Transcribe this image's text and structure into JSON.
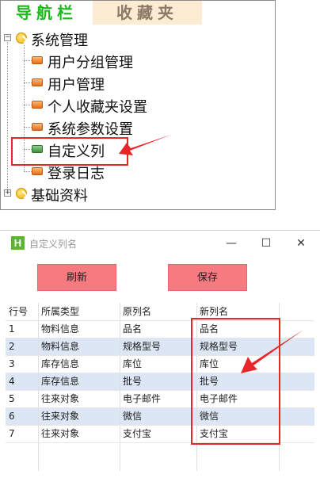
{
  "nav": {
    "tab_active": "导航栏",
    "tab_inactive": "收藏夹",
    "tree": [
      {
        "label": "系统管理",
        "kind": "root",
        "expanded": true
      },
      {
        "label": "用户分组管理",
        "kind": "leaf"
      },
      {
        "label": "用户管理",
        "kind": "leaf"
      },
      {
        "label": "个人收藏夹设置",
        "kind": "leaf"
      },
      {
        "label": "系统参数设置",
        "kind": "leaf"
      },
      {
        "label": "自定义列",
        "kind": "leaf",
        "selected": true
      },
      {
        "label": "登录日志",
        "kind": "leaf"
      },
      {
        "label": "基础资料",
        "kind": "root",
        "expanded": false
      }
    ],
    "expander_minus": "−",
    "expander_plus": "+"
  },
  "dialog": {
    "app_icon_letter": "H",
    "title": "自定义列名",
    "btn_minimize": "—",
    "btn_maximize": "☐",
    "btn_close": "✕",
    "refresh_label": "刷新",
    "save_label": "保存"
  },
  "grid": {
    "headers": [
      "行号",
      "所属类型",
      "原列名",
      "新列名"
    ],
    "rows": [
      [
        "1",
        "物料信息",
        "品名",
        "品名"
      ],
      [
        "2",
        "物料信息",
        "规格型号",
        "规格型号"
      ],
      [
        "3",
        "库存信息",
        "库位",
        "库位"
      ],
      [
        "4",
        "库存信息",
        "批号",
        "批号"
      ],
      [
        "5",
        "往来对象",
        "电子邮件",
        "电子邮件"
      ],
      [
        "6",
        "往来对象",
        "微信",
        "微信"
      ],
      [
        "7",
        "往来对象",
        "支付宝",
        "支付宝"
      ]
    ]
  },
  "colors": {
    "annotation_red": "#e8262a",
    "button_pink": "#f77a80",
    "row_alt_blue": "#dce6f4",
    "nav_active_green": "#1fb81f"
  }
}
